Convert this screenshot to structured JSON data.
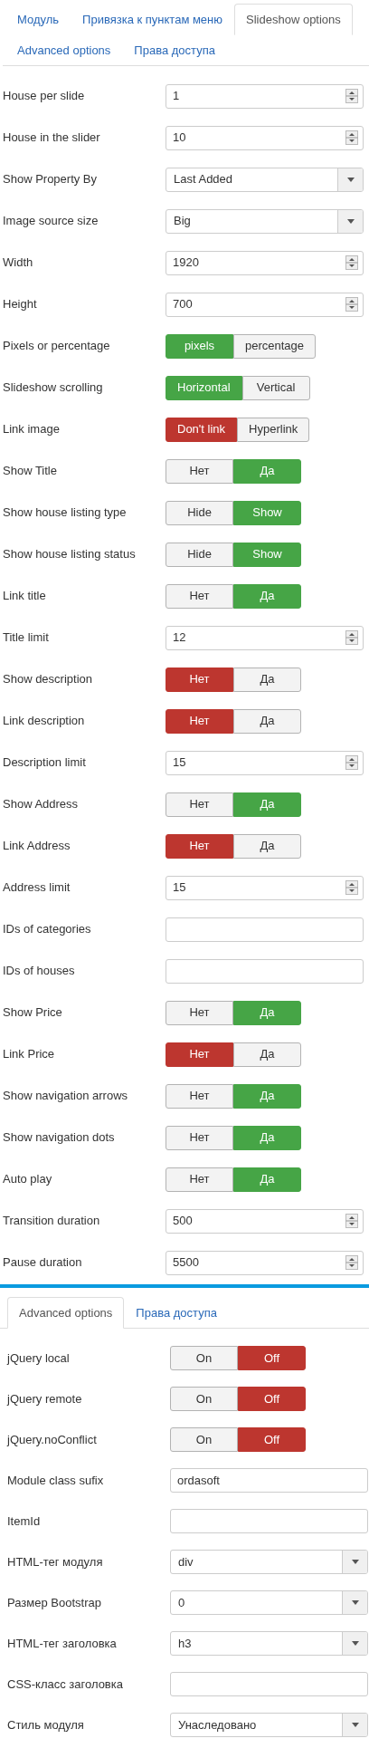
{
  "sections": [
    {
      "tabs": [
        {
          "label": "Модуль",
          "selected": false
        },
        {
          "label": "Привязка к пунктам меню",
          "selected": false
        },
        {
          "label": "Slideshow options",
          "selected": true
        },
        {
          "label": "Advanced options",
          "selected": false
        },
        {
          "label": "Права доступа",
          "selected": false
        }
      ],
      "fields": [
        {
          "label": "House per slide",
          "kind": "number",
          "value": "1"
        },
        {
          "label": "House in the slider",
          "kind": "number",
          "value": "10"
        },
        {
          "label": "Show Property By",
          "kind": "select",
          "value": "Last Added"
        },
        {
          "label": "Image source size",
          "kind": "select",
          "value": "Big"
        },
        {
          "label": "Width",
          "kind": "number",
          "value": "1920"
        },
        {
          "label": "Height",
          "kind": "number",
          "value": "700"
        },
        {
          "label": "Pixels or percentage",
          "kind": "toggle",
          "color": "#46a546",
          "options": [
            {
              "label": "pixels",
              "selected": true
            },
            {
              "label": "percentage",
              "selected": false
            }
          ]
        },
        {
          "label": "Slideshow scrolling",
          "kind": "toggle",
          "color": "#46a546",
          "options": [
            {
              "label": "Horizontal",
              "selected": true
            },
            {
              "label": "Vertical",
              "selected": false
            }
          ]
        },
        {
          "label": "Link image",
          "kind": "toggle",
          "color": "#bd362f",
          "options": [
            {
              "label": "Don't link",
              "selected": true
            },
            {
              "label": "Hyperlink",
              "selected": false
            }
          ]
        },
        {
          "label": "Show Title",
          "kind": "toggle",
          "color": "#46a546",
          "options": [
            {
              "label": "Нет",
              "selected": false
            },
            {
              "label": "Да",
              "selected": true
            }
          ]
        },
        {
          "label": "Show house listing type",
          "kind": "toggle",
          "color": "#46a546",
          "options": [
            {
              "label": "Hide",
              "selected": false
            },
            {
              "label": "Show",
              "selected": true
            }
          ]
        },
        {
          "label": "Show house listing status",
          "kind": "toggle",
          "color": "#46a546",
          "options": [
            {
              "label": "Hide",
              "selected": false
            },
            {
              "label": "Show",
              "selected": true
            }
          ]
        },
        {
          "label": "Link title",
          "kind": "toggle",
          "color": "#46a546",
          "options": [
            {
              "label": "Нет",
              "selected": false
            },
            {
              "label": "Да",
              "selected": true
            }
          ]
        },
        {
          "label": "Title limit",
          "kind": "number",
          "value": "12"
        },
        {
          "label": "Show description",
          "kind": "toggle",
          "color": "#bd362f",
          "options": [
            {
              "label": "Нет",
              "selected": true
            },
            {
              "label": "Да",
              "selected": false
            }
          ]
        },
        {
          "label": "Link description",
          "kind": "toggle",
          "color": "#bd362f",
          "options": [
            {
              "label": "Нет",
              "selected": true
            },
            {
              "label": "Да",
              "selected": false
            }
          ]
        },
        {
          "label": "Description limit",
          "kind": "number",
          "value": "15"
        },
        {
          "label": "Show Address",
          "kind": "toggle",
          "color": "#46a546",
          "options": [
            {
              "label": "Нет",
              "selected": false
            },
            {
              "label": "Да",
              "selected": true
            }
          ]
        },
        {
          "label": "Link Address",
          "kind": "toggle",
          "color": "#bd362f",
          "options": [
            {
              "label": "Нет",
              "selected": true
            },
            {
              "label": "Да",
              "selected": false
            }
          ]
        },
        {
          "label": "Address limit",
          "kind": "number",
          "value": "15"
        },
        {
          "label": "IDs of categories",
          "kind": "text"
        },
        {
          "label": "IDs of houses",
          "kind": "text"
        },
        {
          "label": "Show Price",
          "kind": "toggle",
          "color": "#46a546",
          "options": [
            {
              "label": "Нет",
              "selected": false
            },
            {
              "label": "Да",
              "selected": true
            }
          ]
        },
        {
          "label": "Link Price",
          "kind": "toggle",
          "color": "#bd362f",
          "options": [
            {
              "label": "Нет",
              "selected": true
            },
            {
              "label": "Да",
              "selected": false
            }
          ]
        },
        {
          "label": "Show navigation arrows",
          "kind": "toggle",
          "color": "#46a546",
          "options": [
            {
              "label": "Нет",
              "selected": false
            },
            {
              "label": "Да",
              "selected": true
            }
          ]
        },
        {
          "label": "Show navigation dots",
          "kind": "toggle",
          "color": "#46a546",
          "options": [
            {
              "label": "Нет",
              "selected": false
            },
            {
              "label": "Да",
              "selected": true
            }
          ]
        },
        {
          "label": "Auto play",
          "kind": "toggle",
          "color": "#46a546",
          "options": [
            {
              "label": "Нет",
              "selected": false
            },
            {
              "label": "Да",
              "selected": true
            }
          ]
        },
        {
          "label": "Transition duration",
          "kind": "number",
          "value": "500"
        },
        {
          "label": "Pause duration",
          "kind": "number",
          "value": "5500"
        }
      ]
    },
    {
      "tabs": [
        {
          "label": "Advanced options",
          "selected": true
        },
        {
          "label": "Права доступа",
          "selected": false
        }
      ],
      "fields": [
        {
          "label": "jQuery local",
          "kind": "toggle",
          "color": "#bd362f",
          "options": [
            {
              "label": "On",
              "selected": false
            },
            {
              "label": "Off",
              "selected": true
            }
          ]
        },
        {
          "label": "jQuery remote",
          "kind": "toggle",
          "color": "#bd362f",
          "options": [
            {
              "label": "On",
              "selected": false
            },
            {
              "label": "Off",
              "selected": true
            }
          ]
        },
        {
          "label": "jQuery.noConflict",
          "kind": "toggle",
          "color": "#bd362f",
          "options": [
            {
              "label": "On",
              "selected": false
            },
            {
              "label": "Off",
              "selected": true
            }
          ]
        },
        {
          "label": "Module class sufix",
          "kind": "text",
          "value": "ordasoft"
        },
        {
          "label": "ItemId",
          "kind": "text"
        },
        {
          "label": "HTML-тег модуля",
          "kind": "select",
          "value": "div"
        },
        {
          "label": "Размер Bootstrap",
          "kind": "select",
          "value": "0"
        },
        {
          "label": "HTML-тег заголовка",
          "kind": "select",
          "value": "h3"
        },
        {
          "label": "CSS-класс заголовка",
          "kind": "text"
        },
        {
          "label": "Стиль модуля",
          "kind": "select",
          "value": "Унаследовано"
        }
      ]
    }
  ]
}
